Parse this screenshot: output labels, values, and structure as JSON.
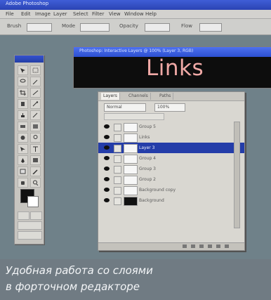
{
  "app": {
    "title": "Adobe Photoshop",
    "menu": [
      "File",
      "Edit",
      "Image",
      "Layer",
      "Select",
      "Filter",
      "View",
      "Window",
      "Help"
    ],
    "options": {
      "brush": "Brush",
      "mode": "Mode",
      "opacity": "Opacity",
      "flow": "Flow"
    }
  },
  "document": {
    "title": "Photoshop: Interactive Layers @ 100% (Layer 3, RGB)",
    "canvas_text": "Links"
  },
  "layers_panel": {
    "tabs": [
      "Layers",
      "Channels",
      "Paths"
    ],
    "blend_mode": "Normal",
    "opacity": "100%",
    "rows": [
      {
        "name": "Group 5",
        "selected": false,
        "eye": true,
        "thumb_black": false
      },
      {
        "name": "Links",
        "selected": false,
        "eye": true,
        "thumb_black": false
      },
      {
        "name": "Layer 3",
        "selected": true,
        "eye": true,
        "thumb_black": false
      },
      {
        "name": "Group 4",
        "selected": false,
        "eye": true,
        "thumb_black": false
      },
      {
        "name": "Group 3",
        "selected": false,
        "eye": true,
        "thumb_black": false
      },
      {
        "name": "Group 2",
        "selected": false,
        "eye": true,
        "thumb_black": false
      },
      {
        "name": "Background copy",
        "selected": false,
        "eye": true,
        "thumb_black": false
      },
      {
        "name": "Background",
        "selected": false,
        "eye": true,
        "thumb_black": true
      }
    ]
  },
  "caption": {
    "line1": "Удобная работа со слоями",
    "line2": "в форточном редакторе"
  }
}
